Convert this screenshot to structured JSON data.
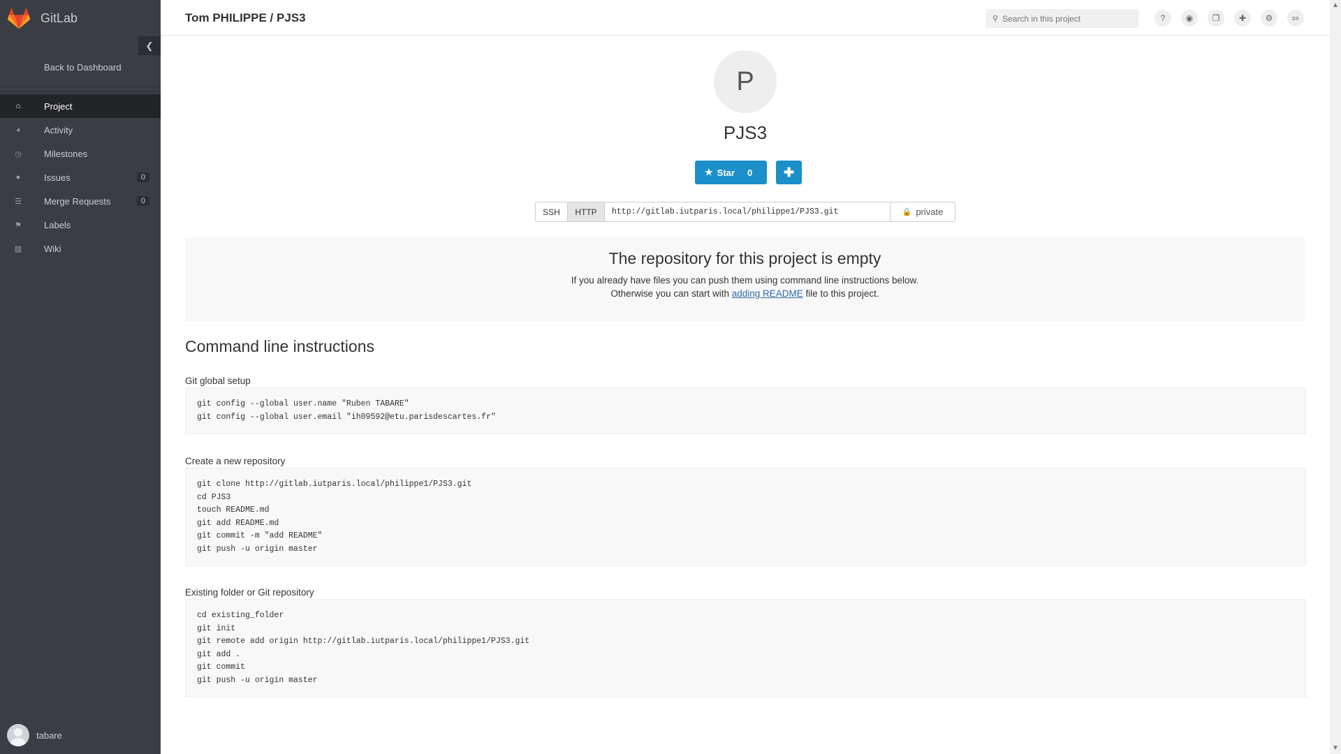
{
  "sidebar": {
    "brand": "GitLab",
    "collapse_icon": "chevron-left-icon",
    "back_link": "Back to Dashboard",
    "items": [
      {
        "label": "Project",
        "icon": "home-icon",
        "active": true
      },
      {
        "label": "Activity",
        "icon": "dashboard-icon"
      },
      {
        "label": "Milestones",
        "icon": "clock-icon"
      },
      {
        "label": "Issues",
        "icon": "exclamation-circle-icon",
        "badge": "0"
      },
      {
        "label": "Merge Requests",
        "icon": "list-icon",
        "badge": "0"
      },
      {
        "label": "Labels",
        "icon": "tags-icon"
      },
      {
        "label": "Wiki",
        "icon": "book-icon"
      }
    ],
    "user": {
      "name": "tabare"
    }
  },
  "header": {
    "title": "Tom PHILIPPE / PJS3",
    "search_placeholder": "Search in this project",
    "icons": [
      "help-icon",
      "globe-icon",
      "copy-icon",
      "plus-icon",
      "gear-icon",
      "sign-out-icon"
    ]
  },
  "project": {
    "avatar_letter": "P",
    "name": "PJS3",
    "star_label": "Star",
    "star_count": "0",
    "clone": {
      "ssh_label": "SSH",
      "http_label": "HTTP",
      "url": "http://gitlab.iutparis.local/philippe1/PJS3.git",
      "visibility": "private"
    }
  },
  "empty": {
    "title": "The repository for this project is empty",
    "line1": "If you already have files you can push them using command line instructions below.",
    "line2_before": "Otherwise you can start with ",
    "line2_link": "adding README",
    "line2_after": " file to this project."
  },
  "instructions": {
    "title": "Command line instructions",
    "global_setup": {
      "label": "Git global setup",
      "code": "git config --global user.name \"Ruben TABARE\"\ngit config --global user.email \"ih09592@etu.parisdescartes.fr\""
    },
    "new_repo": {
      "label": "Create a new repository",
      "code": "git clone http://gitlab.iutparis.local/philippe1/PJS3.git\ncd PJS3\ntouch README.md\ngit add README.md\ngit commit -m \"add README\"\ngit push -u origin master"
    },
    "existing": {
      "label": "Existing folder or Git repository",
      "code": "cd existing_folder\ngit init\ngit remote add origin http://gitlab.iutparis.local/philippe1/PJS3.git\ngit add .\ngit commit\ngit push -u origin master"
    }
  },
  "colors": {
    "sidebar_bg": "#3a3e44",
    "accent": "#1b8fc9",
    "active_item_bg": "#222428"
  }
}
